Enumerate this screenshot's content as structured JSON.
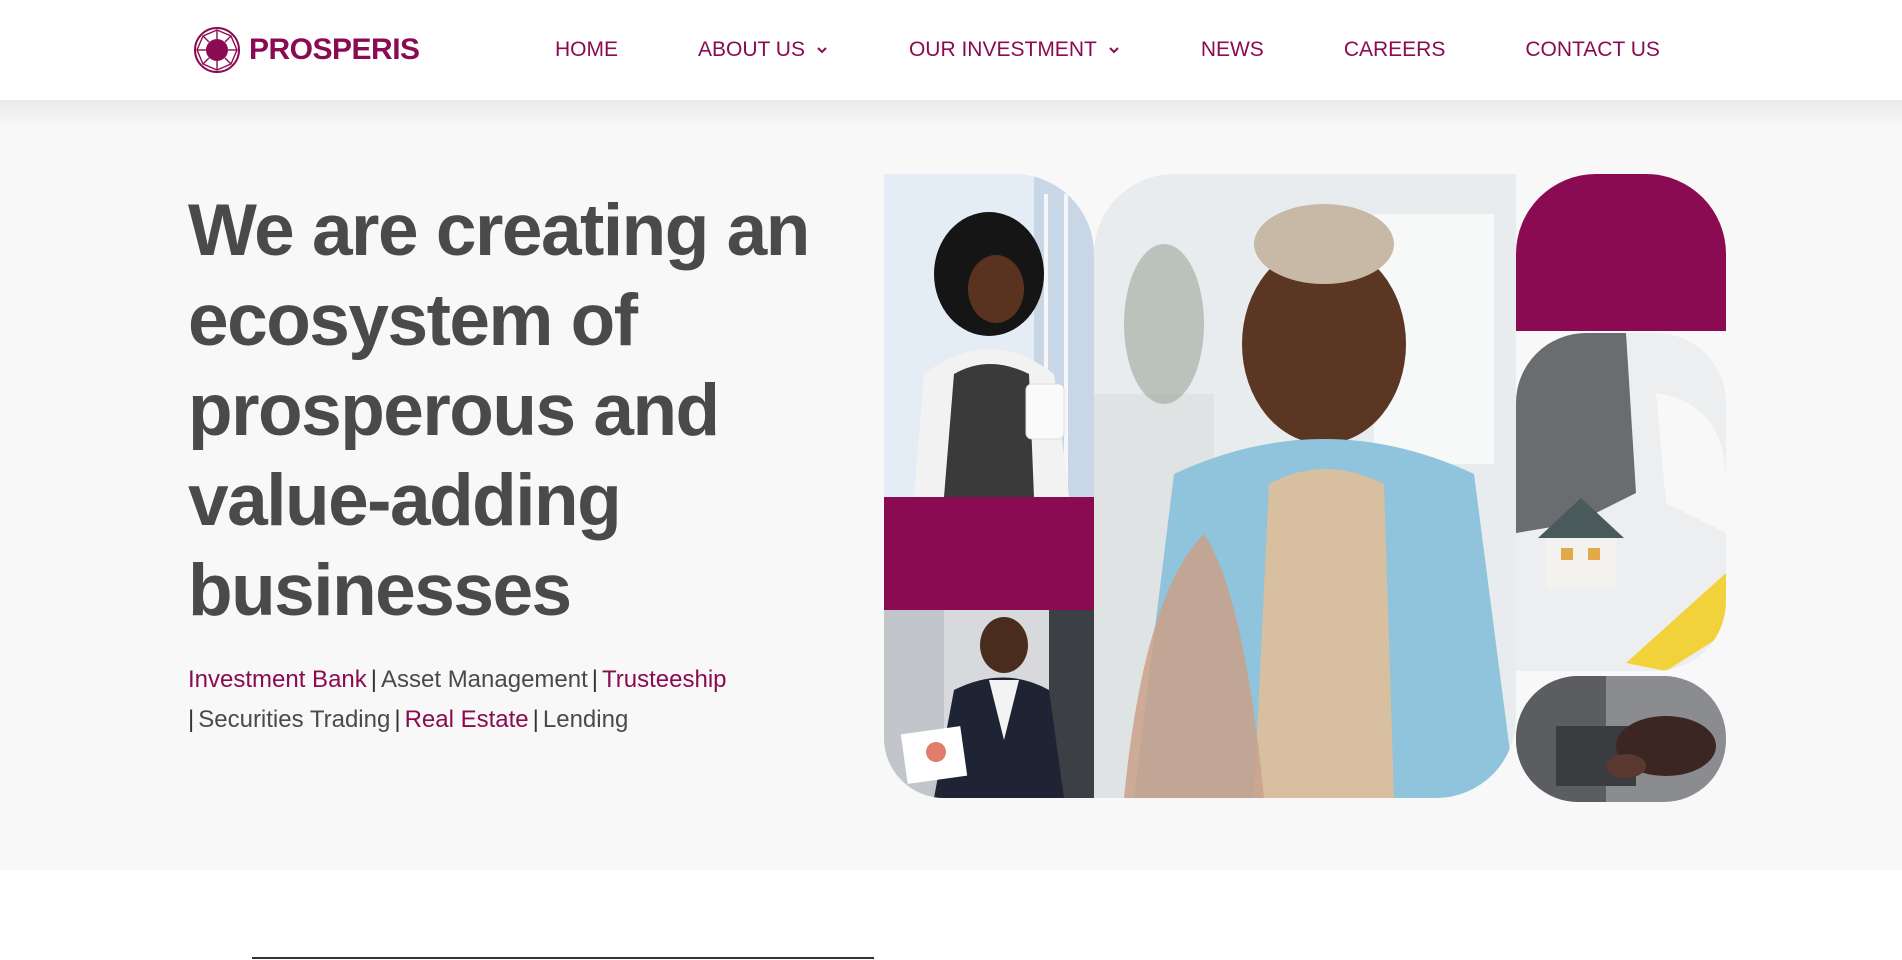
{
  "brand": {
    "name": "PROSPERIS",
    "color": "#8a0b52",
    "icon": "logo-gem-icon"
  },
  "nav": {
    "items": [
      {
        "label": "HOME",
        "dropdown": false
      },
      {
        "label": "ABOUT US",
        "dropdown": true
      },
      {
        "label": "OUR INVESTMENT",
        "dropdown": true
      },
      {
        "label": "NEWS",
        "dropdown": false
      },
      {
        "label": "CAREERS",
        "dropdown": false
      },
      {
        "label": "CONTACT US",
        "dropdown": false
      }
    ]
  },
  "hero": {
    "headline": "We are creating an ecosystem of prosperous and value-adding businesses",
    "services": [
      {
        "label": "Investment Bank",
        "accent": true
      },
      {
        "label": "Asset Management",
        "accent": false
      },
      {
        "label": "Trusteeship",
        "accent": true
      },
      {
        "label": "Securities Trading",
        "accent": false
      },
      {
        "label": "Real Estate",
        "accent": true
      },
      {
        "label": "Lending",
        "accent": false
      }
    ],
    "separator": "|"
  },
  "collage": {
    "images": [
      "woman-with-tablet-photo",
      "man-at-desk-photo",
      "woman-handshake-photo",
      "house-model-photo",
      "laptop-typing-photo"
    ],
    "accent_color": "#8a0b52"
  },
  "colors": {
    "text": "#4a4a48",
    "hero_bg": "#f8f8f8"
  }
}
